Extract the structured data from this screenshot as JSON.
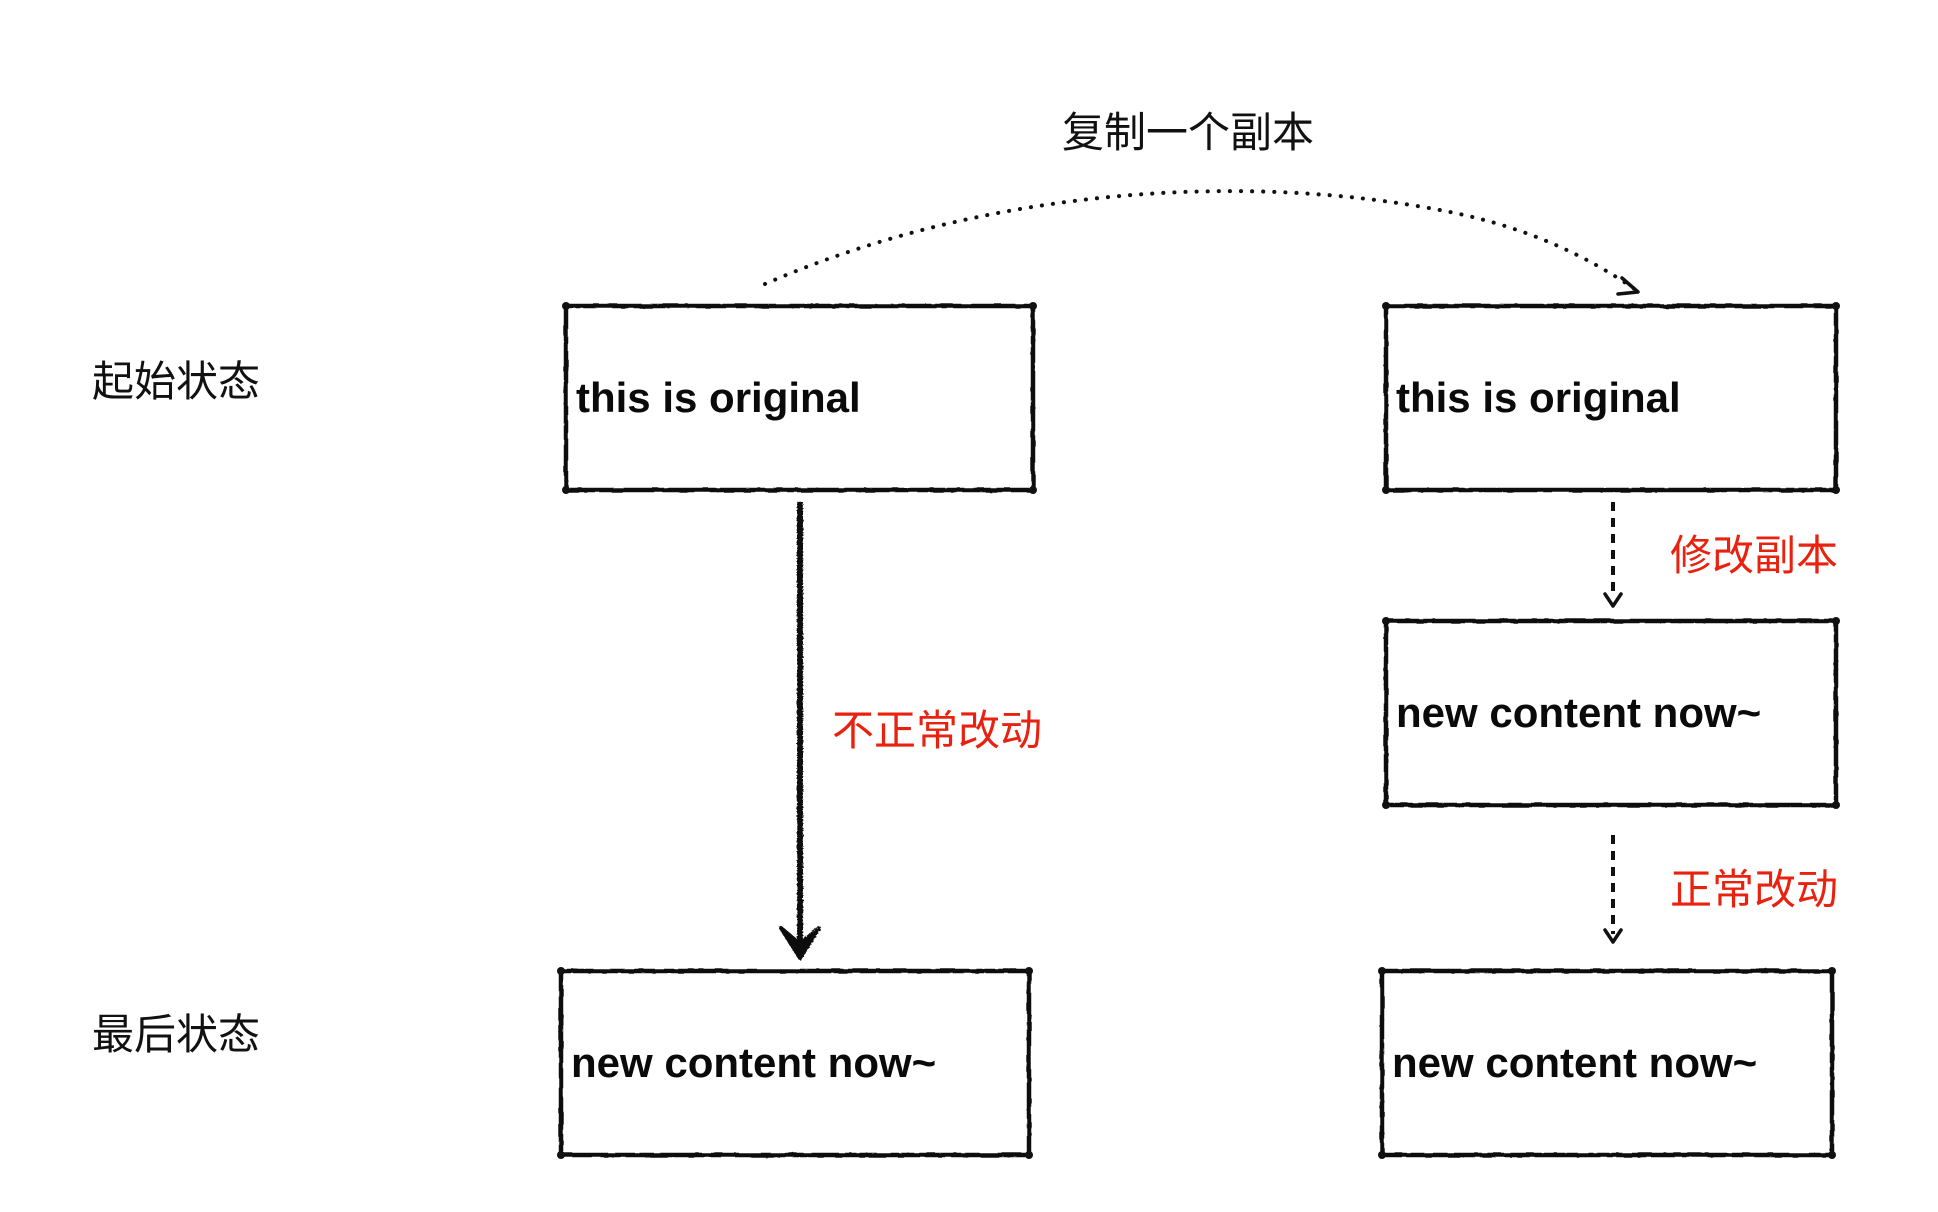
{
  "title": "复制一个副本",
  "row_labels": {
    "initial": "起始状态",
    "final": "最后状态"
  },
  "boxes": {
    "original_initial": "this is original",
    "copy_initial": "this is original",
    "copy_modified": "new content now~",
    "original_final": "new content now~",
    "copy_final": "new content now~"
  },
  "edge_labels": {
    "abnormal_change": "不正常改动",
    "modify_copy": "修改副本",
    "normal_change": "正常改动"
  },
  "colors": {
    "ink": "#111111",
    "accent_red": "#e8220f",
    "background": "#ffffff"
  }
}
